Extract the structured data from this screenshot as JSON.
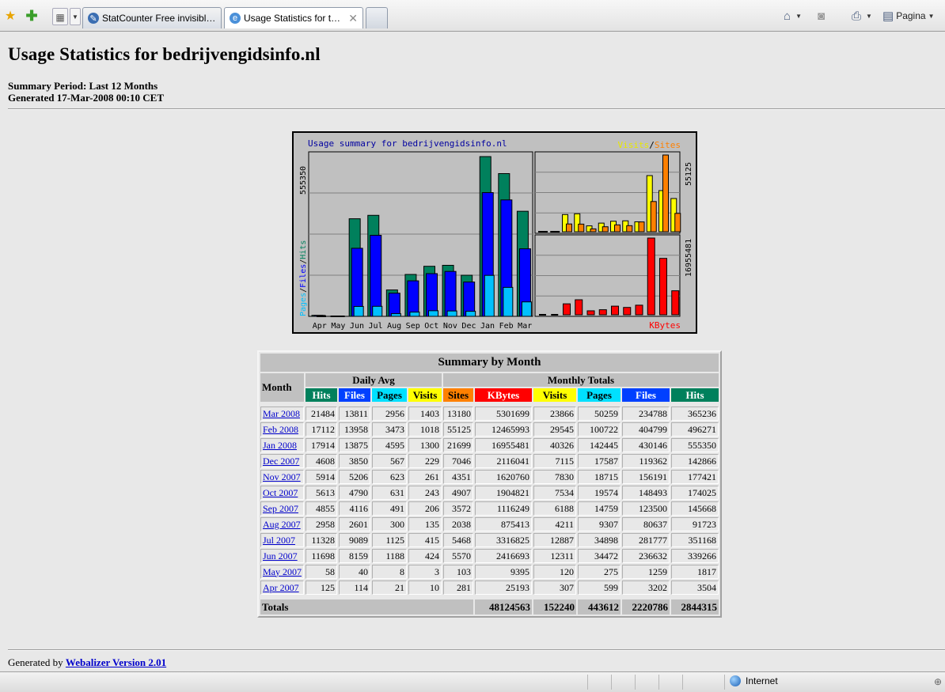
{
  "browser": {
    "tabs": [
      {
        "label": "StatCounter Free invisible W..."
      },
      {
        "label": "Usage Statistics for thijsp..."
      }
    ],
    "page_menu_label": "Pagina",
    "status_zone": "Internet"
  },
  "page": {
    "title": "Usage Statistics for bedrijvengidsinfo.nl",
    "summary_period": "Summary Period: Last 12 Months",
    "generated": "Generated 17-Mar-2008 00:10 CET"
  },
  "chart_data": {
    "type": "bar",
    "title": "Usage summary for bedrijvengidsinfo.nl",
    "categories": [
      "Apr",
      "May",
      "Jun",
      "Jul",
      "Aug",
      "Sep",
      "Oct",
      "Nov",
      "Dec",
      "Jan",
      "Feb",
      "Mar"
    ],
    "left_panel": {
      "ymax_label": "555350",
      "series": [
        {
          "name": "Hits",
          "color": "#00805c",
          "values": [
            3504,
            1817,
            339266,
            351168,
            91723,
            145668,
            174025,
            177421,
            142866,
            555350,
            496271,
            365236
          ]
        },
        {
          "name": "Files",
          "color": "#0000ff",
          "values": [
            3202,
            1259,
            236632,
            281777,
            80637,
            123500,
            148493,
            156191,
            119362,
            430146,
            404799,
            234788
          ]
        },
        {
          "name": "Pages",
          "color": "#00c0ff",
          "values": [
            599,
            275,
            34472,
            34898,
            9307,
            14759,
            19574,
            18715,
            17587,
            142445,
            100722,
            50259
          ]
        }
      ],
      "ylabel_parts": [
        "Pages",
        "/",
        "Files",
        "/",
        "Hits"
      ]
    },
    "right_top_panel": {
      "ymax_label": "55125",
      "legend": [
        "Visits",
        "/",
        "Sites"
      ],
      "series": [
        {
          "name": "Visits",
          "color": "#ffff00",
          "values": [
            307,
            120,
            12311,
            12887,
            4211,
            6188,
            7534,
            7830,
            7115,
            40326,
            29545,
            23866
          ]
        },
        {
          "name": "Sites",
          "color": "#ff8000",
          "values": [
            281,
            103,
            5570,
            5468,
            2038,
            3572,
            4907,
            4351,
            7046,
            21699,
            55125,
            13180
          ]
        }
      ]
    },
    "right_bottom_panel": {
      "ymax_label": "16955481",
      "label": "KBytes",
      "series": [
        {
          "name": "KBytes",
          "color": "#ff0000",
          "values": [
            25193,
            9395,
            2416693,
            3316825,
            875413,
            1116249,
            1904821,
            1620760,
            2116041,
            16955481,
            12465993,
            5301699
          ]
        }
      ]
    }
  },
  "table": {
    "caption": "Summary by Month",
    "month_header": "Month",
    "group_daily": "Daily Avg",
    "group_monthly": "Monthly Totals",
    "daily_cols": [
      "Hits",
      "Files",
      "Pages",
      "Visits"
    ],
    "monthly_cols": [
      "Sites",
      "KBytes",
      "Visits",
      "Pages",
      "Files",
      "Hits"
    ],
    "rows": [
      {
        "month": "Mar 2008",
        "v": [
          "21484",
          "13811",
          "2956",
          "1403",
          "13180",
          "5301699",
          "23866",
          "50259",
          "234788",
          "365236"
        ]
      },
      {
        "month": "Feb 2008",
        "v": [
          "17112",
          "13958",
          "3473",
          "1018",
          "55125",
          "12465993",
          "29545",
          "100722",
          "404799",
          "496271"
        ]
      },
      {
        "month": "Jan 2008",
        "v": [
          "17914",
          "13875",
          "4595",
          "1300",
          "21699",
          "16955481",
          "40326",
          "142445",
          "430146",
          "555350"
        ]
      },
      {
        "month": "Dec 2007",
        "v": [
          "4608",
          "3850",
          "567",
          "229",
          "7046",
          "2116041",
          "7115",
          "17587",
          "119362",
          "142866"
        ]
      },
      {
        "month": "Nov 2007",
        "v": [
          "5914",
          "5206",
          "623",
          "261",
          "4351",
          "1620760",
          "7830",
          "18715",
          "156191",
          "177421"
        ]
      },
      {
        "month": "Oct 2007",
        "v": [
          "5613",
          "4790",
          "631",
          "243",
          "4907",
          "1904821",
          "7534",
          "19574",
          "148493",
          "174025"
        ]
      },
      {
        "month": "Sep 2007",
        "v": [
          "4855",
          "4116",
          "491",
          "206",
          "3572",
          "1116249",
          "6188",
          "14759",
          "123500",
          "145668"
        ]
      },
      {
        "month": "Aug 2007",
        "v": [
          "2958",
          "2601",
          "300",
          "135",
          "2038",
          "875413",
          "4211",
          "9307",
          "80637",
          "91723"
        ]
      },
      {
        "month": "Jul 2007",
        "v": [
          "11328",
          "9089",
          "1125",
          "415",
          "5468",
          "3316825",
          "12887",
          "34898",
          "281777",
          "351168"
        ]
      },
      {
        "month": "Jun 2007",
        "v": [
          "11698",
          "8159",
          "1188",
          "424",
          "5570",
          "2416693",
          "12311",
          "34472",
          "236632",
          "339266"
        ]
      },
      {
        "month": "May 2007",
        "v": [
          "58",
          "40",
          "8",
          "3",
          "103",
          "9395",
          "120",
          "275",
          "1259",
          "1817"
        ]
      },
      {
        "month": "Apr 2007",
        "v": [
          "125",
          "114",
          "21",
          "10",
          "281",
          "25193",
          "307",
          "599",
          "3202",
          "3504"
        ]
      }
    ],
    "totals_label": "Totals",
    "totals": [
      "48124563",
      "152240",
      "443612",
      "2220786",
      "2844315"
    ]
  },
  "footer": {
    "prefix": "Generated by ",
    "link": "Webalizer Version 2.01"
  }
}
